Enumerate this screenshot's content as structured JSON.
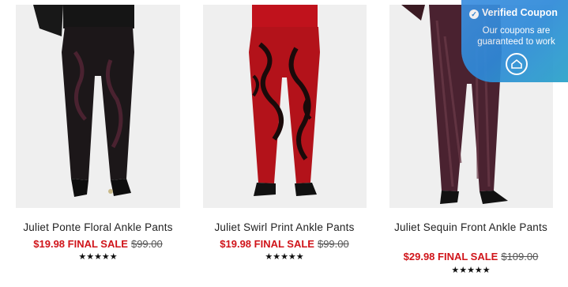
{
  "products": [
    {
      "title": "Juliet Ponte Floral Ankle Pants",
      "sale_price": "$19.98 FINAL SALE",
      "original_price": "$99.00",
      "rating": "★★★★★",
      "image": "black-floral-pants-photo"
    },
    {
      "title": "Juliet Swirl Print Ankle Pants",
      "sale_price": "$19.98 FINAL SALE",
      "original_price": "$99.00",
      "rating": "★★★★★",
      "image": "red-swirl-pants-photo"
    },
    {
      "title": "Juliet Sequin Front Ankle Pants",
      "sale_price": "$29.98 FINAL SALE",
      "original_price": "$109.00",
      "rating": "★★★★★",
      "image": "sequin-pants-photo"
    }
  ],
  "coupon": {
    "title": "Verified Coupon",
    "subtitle": "Our coupons are guaranteed to work",
    "icon": "home-icon"
  },
  "colors": {
    "sale": "#d0141a",
    "coupon_bg": "#2f8ad9"
  }
}
